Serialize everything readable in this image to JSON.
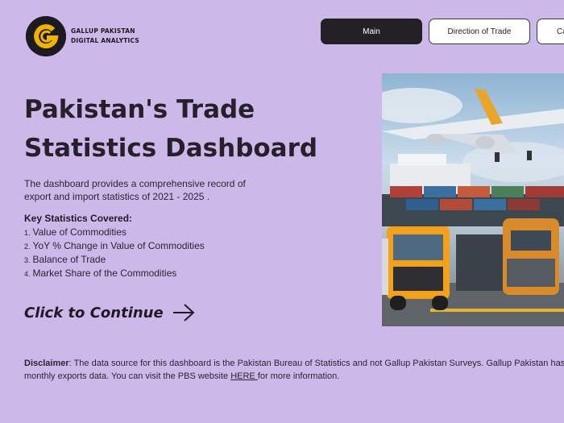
{
  "brand": {
    "line1": "GALLUP PAKISTAN",
    "line2": "DIGITAL ANALYTICS",
    "logo_icon": "gallup-g-logo-icon",
    "accent": "#f0b400"
  },
  "nav": {
    "items": [
      {
        "label": "Main",
        "active": true
      },
      {
        "label": "Direction of Trade",
        "active": false
      },
      {
        "label": "Ca",
        "active": false
      }
    ]
  },
  "hero": {
    "title_line1": "Pakistan's Trade",
    "title_line2": "Statistics Dashboard",
    "description": "The dashboard provides a comprehensive record of export and import statistics of 2021 - 2025 ."
  },
  "key_stats": {
    "heading": "Key Statistics Covered:",
    "items": [
      {
        "num": "1.",
        "text": "Value of Commodities"
      },
      {
        "num": "2.",
        "text": "YoY % Change in Value of Commodities"
      },
      {
        "num": "3.",
        "text": "Balance of Trade"
      },
      {
        "num": "4.",
        "text": "Market Share of the Commodities"
      }
    ]
  },
  "cta": {
    "label": "Click to Continue",
    "icon": "arrow-right-icon"
  },
  "image": {
    "icon": "trade-logistics-photo"
  },
  "disclaimer": {
    "label": "Disclaimer",
    "text": ": The data source for this dashboard is the Pakistan Bureau of Statistics and not Gallup Pakistan Surveys. Gallup Pakistan has only c",
    "text2": "monthly exports data. You can visit the PBS website ",
    "link": "HERE ",
    "text3": "for more information."
  },
  "colors": {
    "background": "#cdb8ea",
    "active_button": "#232126"
  }
}
